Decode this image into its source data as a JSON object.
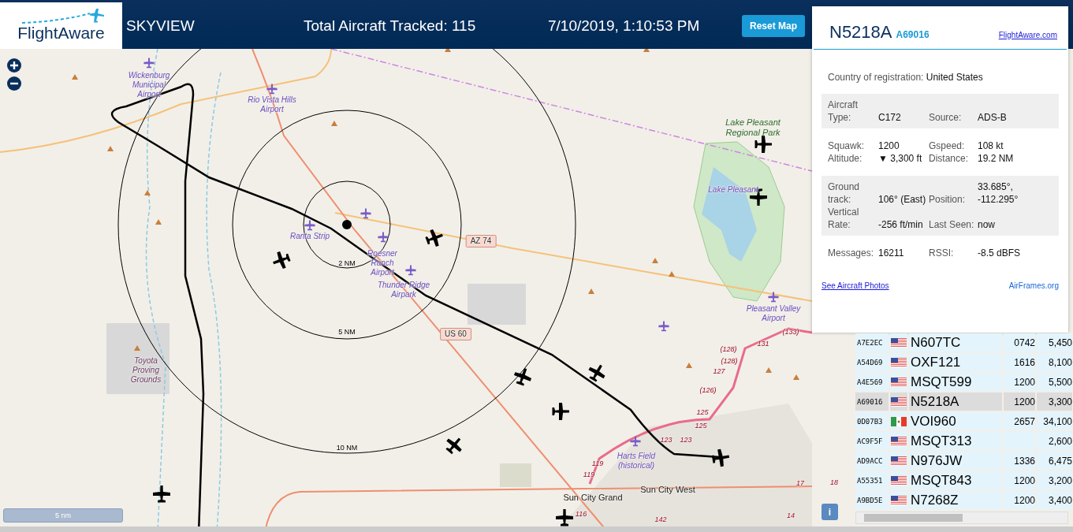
{
  "header": {
    "logo_text": "FlightAware",
    "title": "SKYVIEW",
    "total": "Total Aircraft Tracked: 115",
    "datetime": "7/10/2019, 1:10:53 PM",
    "reset_button": "Reset Map"
  },
  "info": {
    "registration": "N5218A",
    "hex": "A69016",
    "link": "FlightAware.com",
    "country_label": "Country of registration:",
    "country": "United States",
    "sections": [
      {
        "shaded": true,
        "rows": [
          [
            {
              "label": "Aircraft Type:",
              "value": "C172"
            },
            {
              "label": "Source:",
              "value": "ADS-B"
            }
          ]
        ]
      },
      {
        "shaded": false,
        "rows": [
          [
            {
              "label": "Squawk:",
              "value": "1200"
            },
            {
              "label": "Gspeed:",
              "value": "108 kt"
            }
          ],
          [
            {
              "label": "Altitude:",
              "value": "▼ 3,300 ft"
            },
            {
              "label": "Distance:",
              "value": "19.2 NM"
            }
          ]
        ]
      },
      {
        "shaded": true,
        "rows": [
          [
            {
              "label": "Ground track:",
              "value": "106° (East)"
            },
            {
              "label": "Position:",
              "value": "33.685°, -112.295°"
            }
          ],
          [
            {
              "label": "Vertical Rate:",
              "value": "-256 ft/min"
            },
            {
              "label": "Last Seen:",
              "value": "now"
            }
          ]
        ]
      },
      {
        "shaded": false,
        "rows": [
          [
            {
              "label": "Messages:",
              "value": "16211"
            },
            {
              "label": "RSSI:",
              "value": "-8.5 dBFS"
            }
          ]
        ]
      }
    ],
    "photos_link": "See Aircraft Photos",
    "airframes_link": "AirFrames.org"
  },
  "table": {
    "rows": [
      {
        "hex": "A7E2EC",
        "kind": "us",
        "callsign": "N607TC",
        "squawk": "0742",
        "altitude": "5,450",
        "selected": false
      },
      {
        "hex": "A54D69",
        "kind": "us",
        "callsign": "OXF121",
        "squawk": "1616",
        "altitude": "8,100",
        "selected": false
      },
      {
        "hex": "A4E569",
        "kind": "us",
        "callsign": "MSQT599",
        "squawk": "1200",
        "altitude": "5,500",
        "selected": false
      },
      {
        "hex": "A69016",
        "kind": "us",
        "callsign": "N5218A",
        "squawk": "1200",
        "altitude": "3,300",
        "selected": true
      },
      {
        "hex": "0D07B3",
        "kind": "mx",
        "callsign": "VOI960",
        "squawk": "2657",
        "altitude": "34,100",
        "selected": false
      },
      {
        "hex": "AC9F5F",
        "kind": "us",
        "callsign": "MSQT313",
        "altitude": "2,600",
        "selected": false
      },
      {
        "hex": "AD9ACC",
        "kind": "us",
        "callsign": "N976JW",
        "squawk": "1336",
        "altitude": "6,475",
        "selected": false
      },
      {
        "hex": "A55351",
        "kind": "us",
        "callsign": "MSQT843",
        "squawk": "1200",
        "altitude": "3,200",
        "selected": false
      },
      {
        "hex": "A9BD5E",
        "kind": "us",
        "callsign": "N7268Z",
        "squawk": "1200",
        "altitude": "3,400",
        "selected": false
      }
    ]
  },
  "map": {
    "scale": "5 nm",
    "info_button": "i",
    "labels": [
      {
        "text": "Wickenburg Municipal Airport",
        "kind": "airport"
      },
      {
        "text": "Rio Vista Hills Airport",
        "kind": "airport"
      },
      {
        "text": "Ranta Strip",
        "kind": "airport"
      },
      {
        "text": "Roesner Ranch Airport",
        "kind": "airport"
      },
      {
        "text": "Thunder Ridge Airpark",
        "kind": "airport"
      },
      {
        "text": "Toyota Proving Grounds",
        "kind": "area"
      },
      {
        "text": "Lake Pleasant Regional Park",
        "kind": "park"
      },
      {
        "text": "Lake Pleasant",
        "kind": "airport"
      },
      {
        "text": "Pleasant Valley Airport",
        "kind": "airport"
      },
      {
        "text": "Harts Field (historical)",
        "kind": "airport"
      },
      {
        "text": "Sun City Grand",
        "kind": "place"
      },
      {
        "text": "Sun City West",
        "kind": "place"
      },
      {
        "text": "AZ 74",
        "kind": "shield"
      },
      {
        "text": "US 60",
        "kind": "shield"
      },
      {
        "text": "2 NM",
        "kind": "ring"
      },
      {
        "text": "5 NM",
        "kind": "ring"
      },
      {
        "text": "10 NM",
        "kind": "ring"
      },
      {
        "text": "(128)",
        "kind": "exit"
      },
      {
        "text": "(128)",
        "kind": "exit"
      },
      {
        "text": "127",
        "kind": "exit"
      },
      {
        "text": "(126)",
        "kind": "exit"
      },
      {
        "text": "125",
        "kind": "exit"
      },
      {
        "text": "125",
        "kind": "exit"
      },
      {
        "text": "123",
        "kind": "exit"
      },
      {
        "text": "123",
        "kind": "exit"
      },
      {
        "text": "131",
        "kind": "exit"
      },
      {
        "text": "(133)",
        "kind": "exit"
      },
      {
        "text": "119",
        "kind": "exit"
      },
      {
        "text": "119",
        "kind": "exit"
      },
      {
        "text": "116",
        "kind": "exit"
      },
      {
        "text": "142",
        "kind": "exit"
      },
      {
        "text": "17",
        "kind": "exit"
      },
      {
        "text": "18",
        "kind": "exit"
      },
      {
        "text": "14",
        "kind": "exit"
      }
    ]
  }
}
